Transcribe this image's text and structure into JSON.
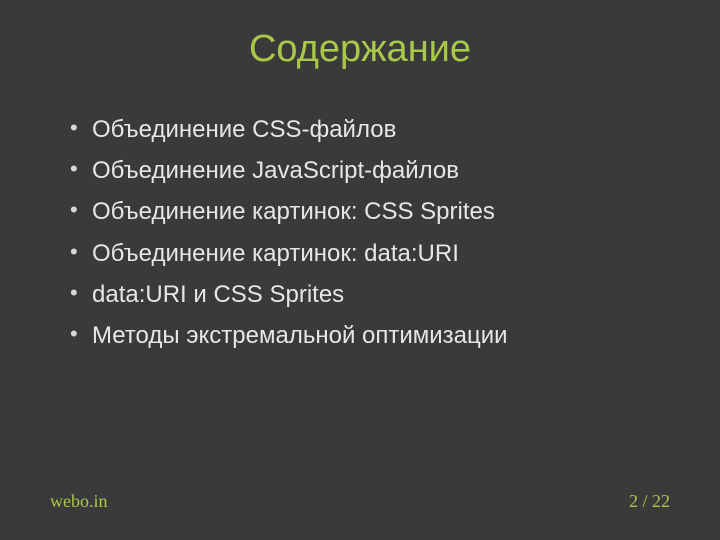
{
  "title": "Содержание",
  "bullets": [
    "Объединение CSS-файлов",
    "Объединение JavaScript-файлов",
    "Объединение картинок: CSS Sprites",
    "Объединение картинок: data:URI",
    "data:URI и CSS Sprites",
    "Методы экстремальной оптимизации"
  ],
  "footer": {
    "site": "webo.in",
    "page": "2 / 22"
  }
}
